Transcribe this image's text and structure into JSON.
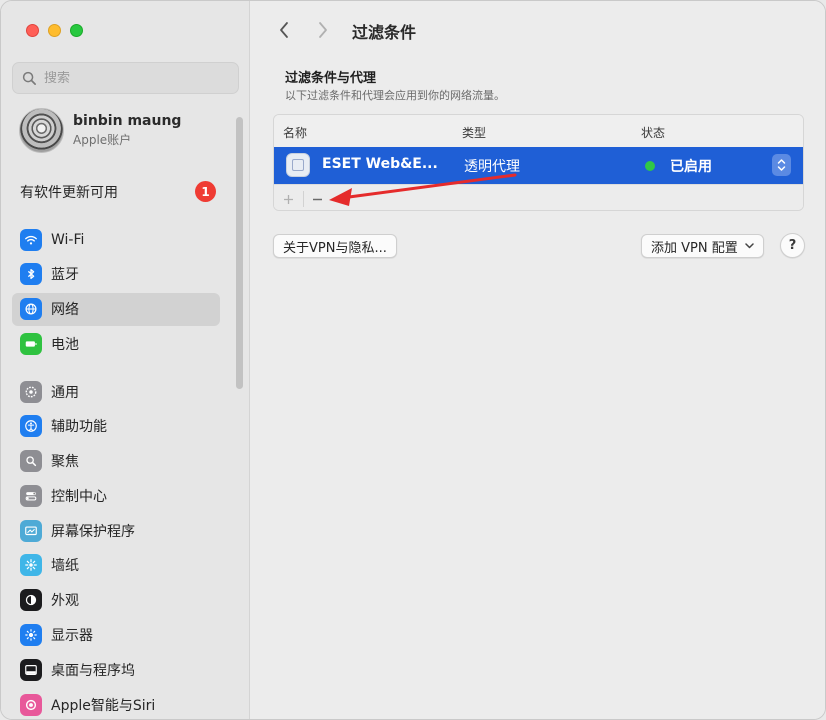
{
  "sidebar": {
    "search_placeholder": "搜索",
    "account": {
      "name": "binbin maung",
      "subtitle": "Apple账户"
    },
    "update": {
      "label": "有软件更新可用",
      "badge": "1"
    },
    "groups": [
      [
        {
          "label": "Wi-Fi",
          "icon": "wifi-icon",
          "color": "#1f7ef0"
        },
        {
          "label": "蓝牙",
          "icon": "bluetooth-icon",
          "color": "#1f7ef0"
        },
        {
          "label": "网络",
          "icon": "globe-icon",
          "color": "#1f7ef0",
          "selected": true
        },
        {
          "label": "电池",
          "icon": "battery-icon",
          "color": "#2fc240"
        }
      ],
      [
        {
          "label": "通用",
          "icon": "gear-icon",
          "color": "#8e8e93"
        },
        {
          "label": "辅助功能",
          "icon": "accessibility-icon",
          "color": "#1f7ef0"
        },
        {
          "label": "聚焦",
          "icon": "spotlight-icon",
          "color": "#8e8e93"
        },
        {
          "label": "控制中心",
          "icon": "control-center-icon",
          "color": "#8e8e93"
        },
        {
          "label": "屏幕保护程序",
          "icon": "screensaver-icon",
          "color": "#4eaad6"
        },
        {
          "label": "墙纸",
          "icon": "wallpaper-icon",
          "color": "#3fb6e8"
        },
        {
          "label": "外观",
          "icon": "appearance-icon",
          "color": "#1c1c1e"
        },
        {
          "label": "显示器",
          "icon": "display-icon",
          "color": "#1f7ef0"
        },
        {
          "label": "桌面与程序坞",
          "icon": "dock-icon",
          "color": "#1c1c1e"
        },
        {
          "label": "Apple智能与Siri",
          "icon": "siri-icon",
          "color": "#e8589a"
        }
      ]
    ]
  },
  "main": {
    "title": "过滤条件",
    "section_title": "过滤条件与代理",
    "section_subtitle": "以下过滤条件和代理会应用到你的网络流量。",
    "table": {
      "headers": [
        "名称",
        "类型",
        "状态"
      ],
      "rows": [
        {
          "name": "ESET Web&E...",
          "type": "透明代理",
          "status": "已启用",
          "status_color": "#30c845"
        }
      ]
    },
    "about_button": "关于VPN与隐私...",
    "add_vpn_button": "添加 VPN 配置",
    "help_button": "?"
  },
  "colors": {
    "accent": "#1f5fd6",
    "annotation_arrow": "#e52b2b"
  }
}
